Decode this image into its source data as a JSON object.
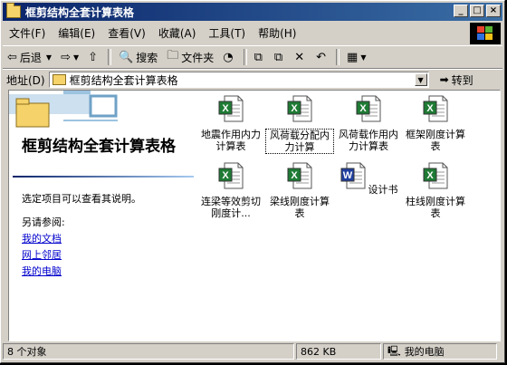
{
  "window": {
    "title": "框剪结构全套计算表格"
  },
  "menu": [
    "文件(F)",
    "编辑(E)",
    "查看(V)",
    "收藏(A)",
    "工具(T)",
    "帮助(H)"
  ],
  "toolbar": {
    "back": "后退",
    "search": "搜索",
    "folders": "文件夹"
  },
  "address": {
    "label": "地址(D)",
    "value": "框剪结构全套计算表格",
    "go": "转到"
  },
  "leftpane": {
    "title": "框剪结构全套计算表格",
    "hint": "选定项目可以查看其说明。",
    "see_also": "另请参阅:",
    "links": [
      "我的文档",
      "网上邻居",
      "我的电脑"
    ]
  },
  "files": [
    {
      "name": "地震作用内力计算表",
      "type": "excel"
    },
    {
      "name": "风荷载分配内力计算",
      "type": "excel",
      "selected": true
    },
    {
      "name": "风荷载作用内力计算表",
      "type": "excel"
    },
    {
      "name": "框架刚度计算表",
      "type": "excel"
    },
    {
      "name": "连梁等效剪切刚度计...",
      "type": "excel"
    },
    {
      "name": "梁线刚度计算表",
      "type": "excel"
    },
    {
      "name": "设计书",
      "type": "word"
    },
    {
      "name": "柱线刚度计算表",
      "type": "excel"
    }
  ],
  "status": {
    "objects": "8 个对象",
    "size": "862 KB",
    "location": "我的电脑"
  },
  "colors": {
    "title_start": "#0a246a",
    "title_end": "#3a6ea5",
    "excel_green": "#1e7b34",
    "word_blue": "#1f3f9f"
  }
}
